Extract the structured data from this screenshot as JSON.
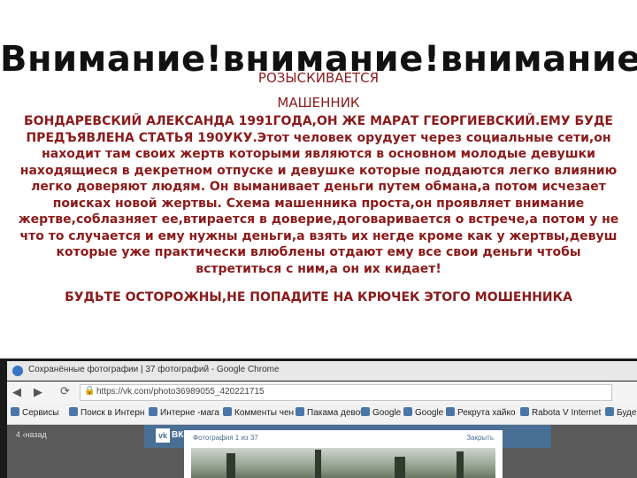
{
  "title": "Внимание!внимание!внимание!",
  "subtitle1": "РОЗЫСКИВАЕТСЯ",
  "subtitle2": "МАШЕННИК",
  "body_lines": [
    "БОНДАРЕВСКИЙ АЛЕКСАНДА 1991ГОДА,ОН ЖЕ МАРАТ ГЕОРГИЕВСКИЙ.ЕМУ БУДЕ",
    "ПРЕДЪЯВЛЕНА СТАТЬЯ 190УКУ.Этот человек орудует через социальные сети,он",
    "находит там своих жертв которыми являются в основном молодые девушки",
    "находящиеся в декретном отпуске и девушке которые поддаются легко влиянию",
    "легко доверяют людям. Он выманивает деньги путем обмана,а потом исчезает",
    "поисках новой жертвы. Схема машенника проста,он проявляет внимание",
    "жертве,соблазняет ее,втирается в доверие,договаривается о встрече,а потом у не",
    "что то случается и ему нужны деньги,а взять их негде кроме как у жертвы,девуш",
    "которые уже практически влюблены отдают ему все свои деньги чтобы",
    "встретиться с ним,а он их кидает!"
  ],
  "warning": "БУДЬТЕ ОСТОРОЖНЫ,НЕ ПОПАДИТЕ НА КРЮЧЕК  ЭТОГО МОШЕННИКА",
  "browser": {
    "window_title": "Сохранённые фотографии | 37 фотографий - Google Chrome",
    "url": "https://vk.com/photo36989055_420221715",
    "bookmarks": [
      "Сервисы",
      "Поиск в Интерн",
      "Интерне -мага",
      "Комменты чен",
      "Пакама девоч-",
      "Google",
      "Google",
      "Рекрута хайко",
      "Rabota V Internet",
      "Буде"
    ],
    "vk_label": "ВКон",
    "back_label": "4 ‹назад",
    "photo_counter": "Фотография 1 из 37",
    "close_label": "Закрыть"
  }
}
